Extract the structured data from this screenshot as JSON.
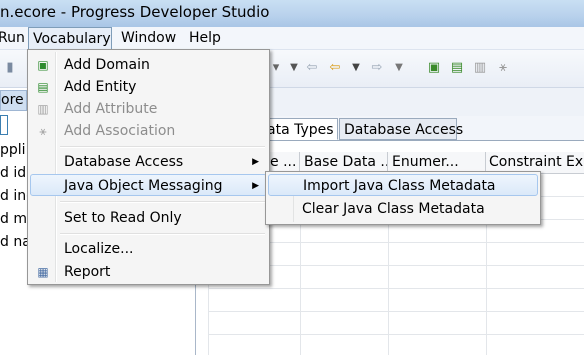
{
  "window": {
    "title": "n.ecore - Progress Developer Studio"
  },
  "menubar": {
    "items": [
      {
        "label": "Run"
      },
      {
        "label": "Vocabulary"
      },
      {
        "label": "Window"
      },
      {
        "label": "Help"
      }
    ]
  },
  "left_panel": {
    "header": "ore",
    "rows": [
      "ppli",
      "d id",
      "d inc",
      "d ma",
      "d nar"
    ]
  },
  "editor": {
    "tabs": [
      {
        "label": "ata Types"
      },
      {
        "label": "Database Access"
      }
    ],
    "columns": [
      "e ...",
      "Base Data ...",
      "Enumer...",
      "Constraint Exp"
    ]
  },
  "vocabulary_menu": {
    "items": [
      {
        "label": "Add Domain",
        "icon": "add-domain-icon",
        "enabled": true
      },
      {
        "label": "Add Entity",
        "icon": "add-entity-icon",
        "enabled": true
      },
      {
        "label": "Add Attribute",
        "icon": "add-attribute-icon",
        "enabled": false
      },
      {
        "label": "Add Association",
        "icon": "add-association-icon",
        "enabled": false
      },
      {
        "label": "Database Access",
        "submenu": true
      },
      {
        "label": "Java Object Messaging",
        "submenu": true,
        "highlighted": true
      },
      {
        "label": "Set to Read Only"
      },
      {
        "label": "Localize..."
      },
      {
        "label": "Report",
        "icon": "report-icon"
      }
    ]
  },
  "java_submenu": {
    "items": [
      {
        "label": "Import Java Class Metadata",
        "highlighted": true
      },
      {
        "label": "Clear Java Class Metadata"
      }
    ]
  }
}
